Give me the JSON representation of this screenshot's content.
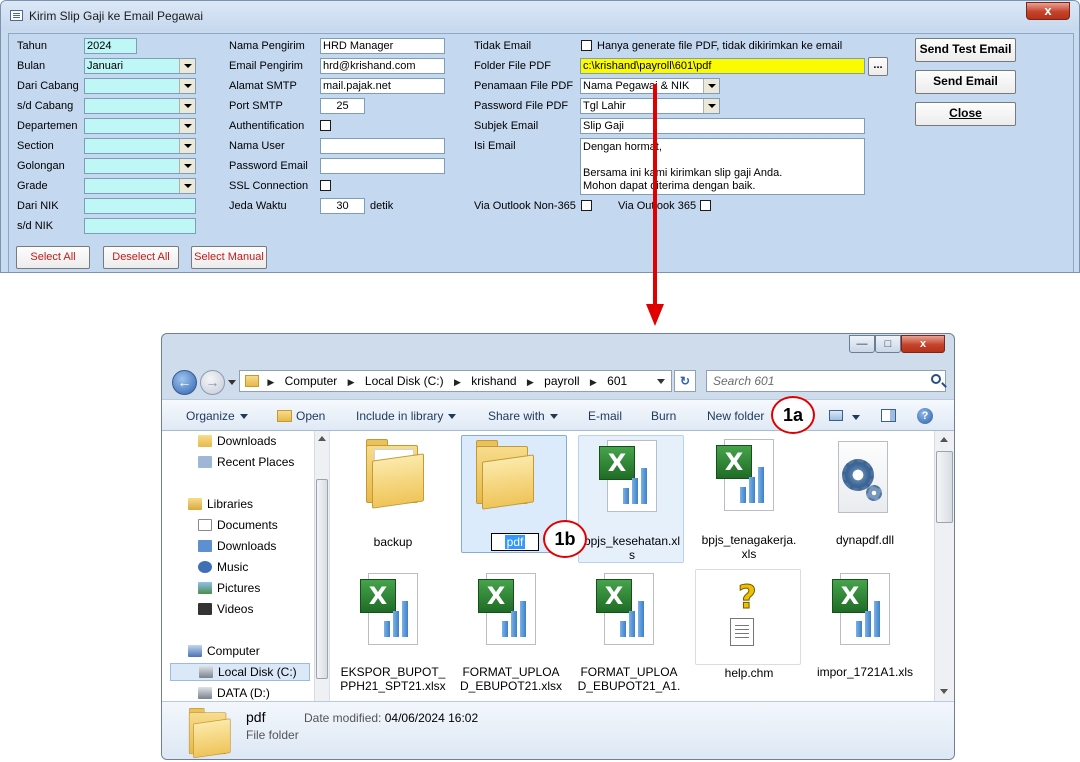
{
  "dialog": {
    "title": "Kirim Slip Gaji ke Email Pegawai",
    "close_glyph": "x",
    "col1": {
      "tahun_label": "Tahun",
      "tahun_value": "2024",
      "bulan_label": "Bulan",
      "bulan_value": "Januari",
      "dari_cabang_label": "Dari Cabang",
      "sd_cabang_label": "s/d Cabang",
      "departemen_label": "Departemen",
      "section_label": "Section",
      "golongan_label": "Golongan",
      "grade_label": "Grade",
      "dari_nik_label": "Dari NIK",
      "sd_nik_label": "s/d NIK"
    },
    "col2": {
      "nama_pengirim_label": "Nama Pengirim",
      "nama_pengirim_value": "HRD Manager",
      "email_pengirim_label": "Email Pengirim",
      "email_pengirim_value": "hrd@krishand.com",
      "alamat_smtp_label": "Alamat SMTP",
      "alamat_smtp_value": "mail.pajak.net",
      "port_smtp_label": "Port SMTP",
      "port_smtp_value": "25",
      "authentification_label": "Authentification",
      "nama_user_label": "Nama User",
      "password_email_label": "Password Email",
      "ssl_label": "SSL Connection",
      "jeda_label": "Jeda Waktu",
      "jeda_value": "30",
      "jeda_unit": "detik"
    },
    "col3": {
      "tidak_email_label": "Tidak Email",
      "tidak_email_text": "Hanya generate file PDF, tidak dikirimkan ke email",
      "folder_pdf_label": "Folder File PDF",
      "folder_pdf_value": "c:\\krishand\\payroll\\601\\pdf",
      "browse_label": "...",
      "penamaan_label": "Penamaan File PDF",
      "penamaan_value": "Nama Pegawai & NIK",
      "password_pdf_label": "Password File PDF",
      "password_pdf_value": "Tgl Lahir",
      "subjek_label": "Subjek Email",
      "subjek_value": "Slip Gaji",
      "isi_label": "Isi Email",
      "isi_line1": "Dengan hormat,",
      "isi_line2": "Bersama ini kami kirimkan slip gaji Anda.",
      "isi_line3": "Mohon dapat diterima dengan baik.",
      "outlook_non365_label": "Via Outlook Non-365",
      "outlook_365_label": "Via Outlook 365"
    },
    "buttons": {
      "send_test": "Send Test Email",
      "send_email": "Send Email",
      "close": "Close",
      "select_all": "Select All",
      "deselect_all": "Deselect All",
      "select_manual": "Select Manual"
    }
  },
  "explorer": {
    "window_controls": {
      "minimize": "—",
      "maximize": "□",
      "close": "x"
    },
    "breadcrumb": [
      "Computer",
      "Local Disk (C:)",
      "krishand",
      "payroll",
      "601"
    ],
    "search_placeholder": "Search 601",
    "toolbar": {
      "organize": "Organize",
      "open": "Open",
      "include": "Include in library",
      "share": "Share with",
      "email": "E-mail",
      "burn": "Burn",
      "new_folder": "New folder"
    },
    "nav": {
      "downloads_top": "Downloads",
      "recent": "Recent Places",
      "libraries": "Libraries",
      "documents": "Documents",
      "downloads": "Downloads",
      "music": "Music",
      "pictures": "Pictures",
      "videos": "Videos",
      "computer": "Computer",
      "local_disk": "Local Disk (C:)",
      "data": "DATA (D:)"
    },
    "files": {
      "backup": "backup",
      "pdf": "pdf",
      "bpjs_kes_1": "bpjs_kesehatan.xl",
      "bpjs_kes_2": "s",
      "bpjs_tk_1": "bpjs_tenagakerja.",
      "bpjs_tk_2": "xls",
      "dynapdf": "dynapdf.dll",
      "ekspor_1": "EKSPOR_BUPOT_",
      "ekspor_2": "PPH21_SPT21.xlsx",
      "format1_1": "FORMAT_UPLOA",
      "format1_2": "D_EBUPOT21.xlsx",
      "format2_1": "FORMAT_UPLOA",
      "format2_2": "D_EBUPOT21_A1.",
      "help": "help.chm",
      "impor": "impor_1721A1.xls"
    },
    "details": {
      "name": "pdf",
      "modified_label": "Date modified:",
      "modified_value": "04/06/2024 16:02",
      "type": "File folder"
    }
  },
  "callouts": {
    "c1a": "1a",
    "c1b": "1b"
  },
  "colors": {
    "arrow": "#e00000",
    "folder_field": "#fbfb00",
    "cyan_field": "#bff6f6"
  }
}
